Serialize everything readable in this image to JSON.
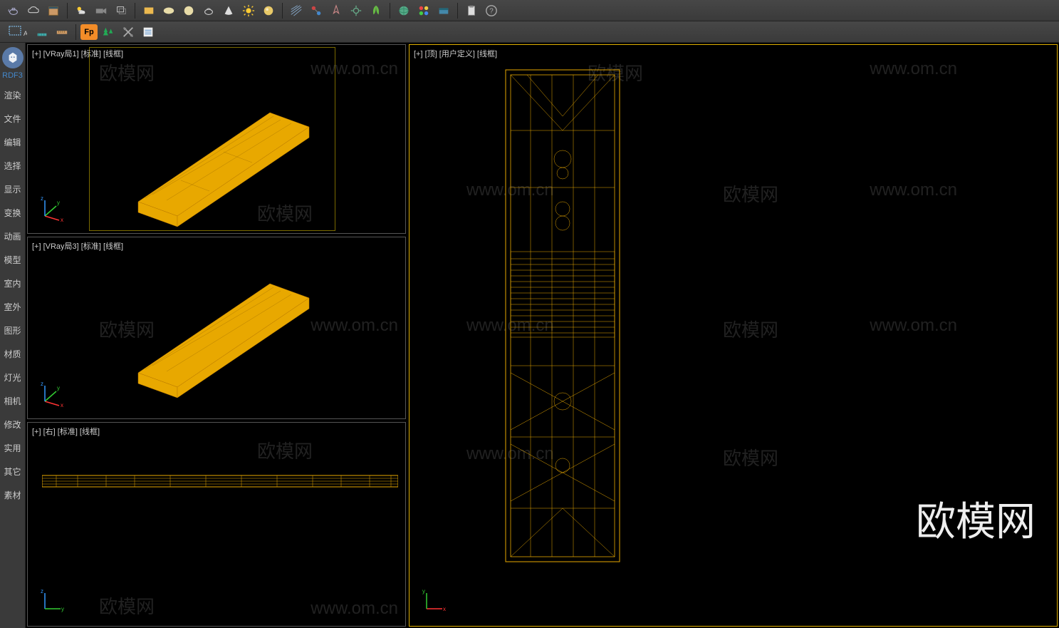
{
  "toolbar": {
    "row1_icons": [
      "teapot-icon",
      "cloud-icon",
      "calendar-icon",
      "weather-icon",
      "camera-icon",
      "layers-icon",
      "rect-icon",
      "oval-icon",
      "circle-icon",
      "kettle-icon",
      "cone-icon",
      "sun-icon",
      "sphere-icon",
      "hatch-icon",
      "node-icon",
      "compass-icon",
      "gear-icon",
      "leaf-icon",
      "globe-icon",
      "palette-icon",
      "drive-icon",
      "clipboard-icon",
      "help-icon"
    ],
    "row2": {
      "dots_label": "A",
      "fp_label": "Fp"
    }
  },
  "sidebar": {
    "top_label": "RDF3",
    "items": [
      "渲染",
      "文件",
      "编辑",
      "选择",
      "显示",
      "变换",
      "动画",
      "模型",
      "室内",
      "室外",
      "图形",
      "材质",
      "灯光",
      "相机",
      "修改",
      "实用",
      "其它",
      "素材"
    ]
  },
  "viewports": {
    "vp1": {
      "label": "[+] [VRay局1] [标准] [线框]"
    },
    "vp2": {
      "label": "[+] [VRay局3] [标准] [线框]"
    },
    "vp3": {
      "label": "[+] [右] [标准] [线框]"
    },
    "vp_right": {
      "label": "[+] [顶] [用户定义] [线框]"
    }
  },
  "watermarks": {
    "cn": "欧模网",
    "en": "www.om.cn",
    "brand": "欧模网"
  }
}
